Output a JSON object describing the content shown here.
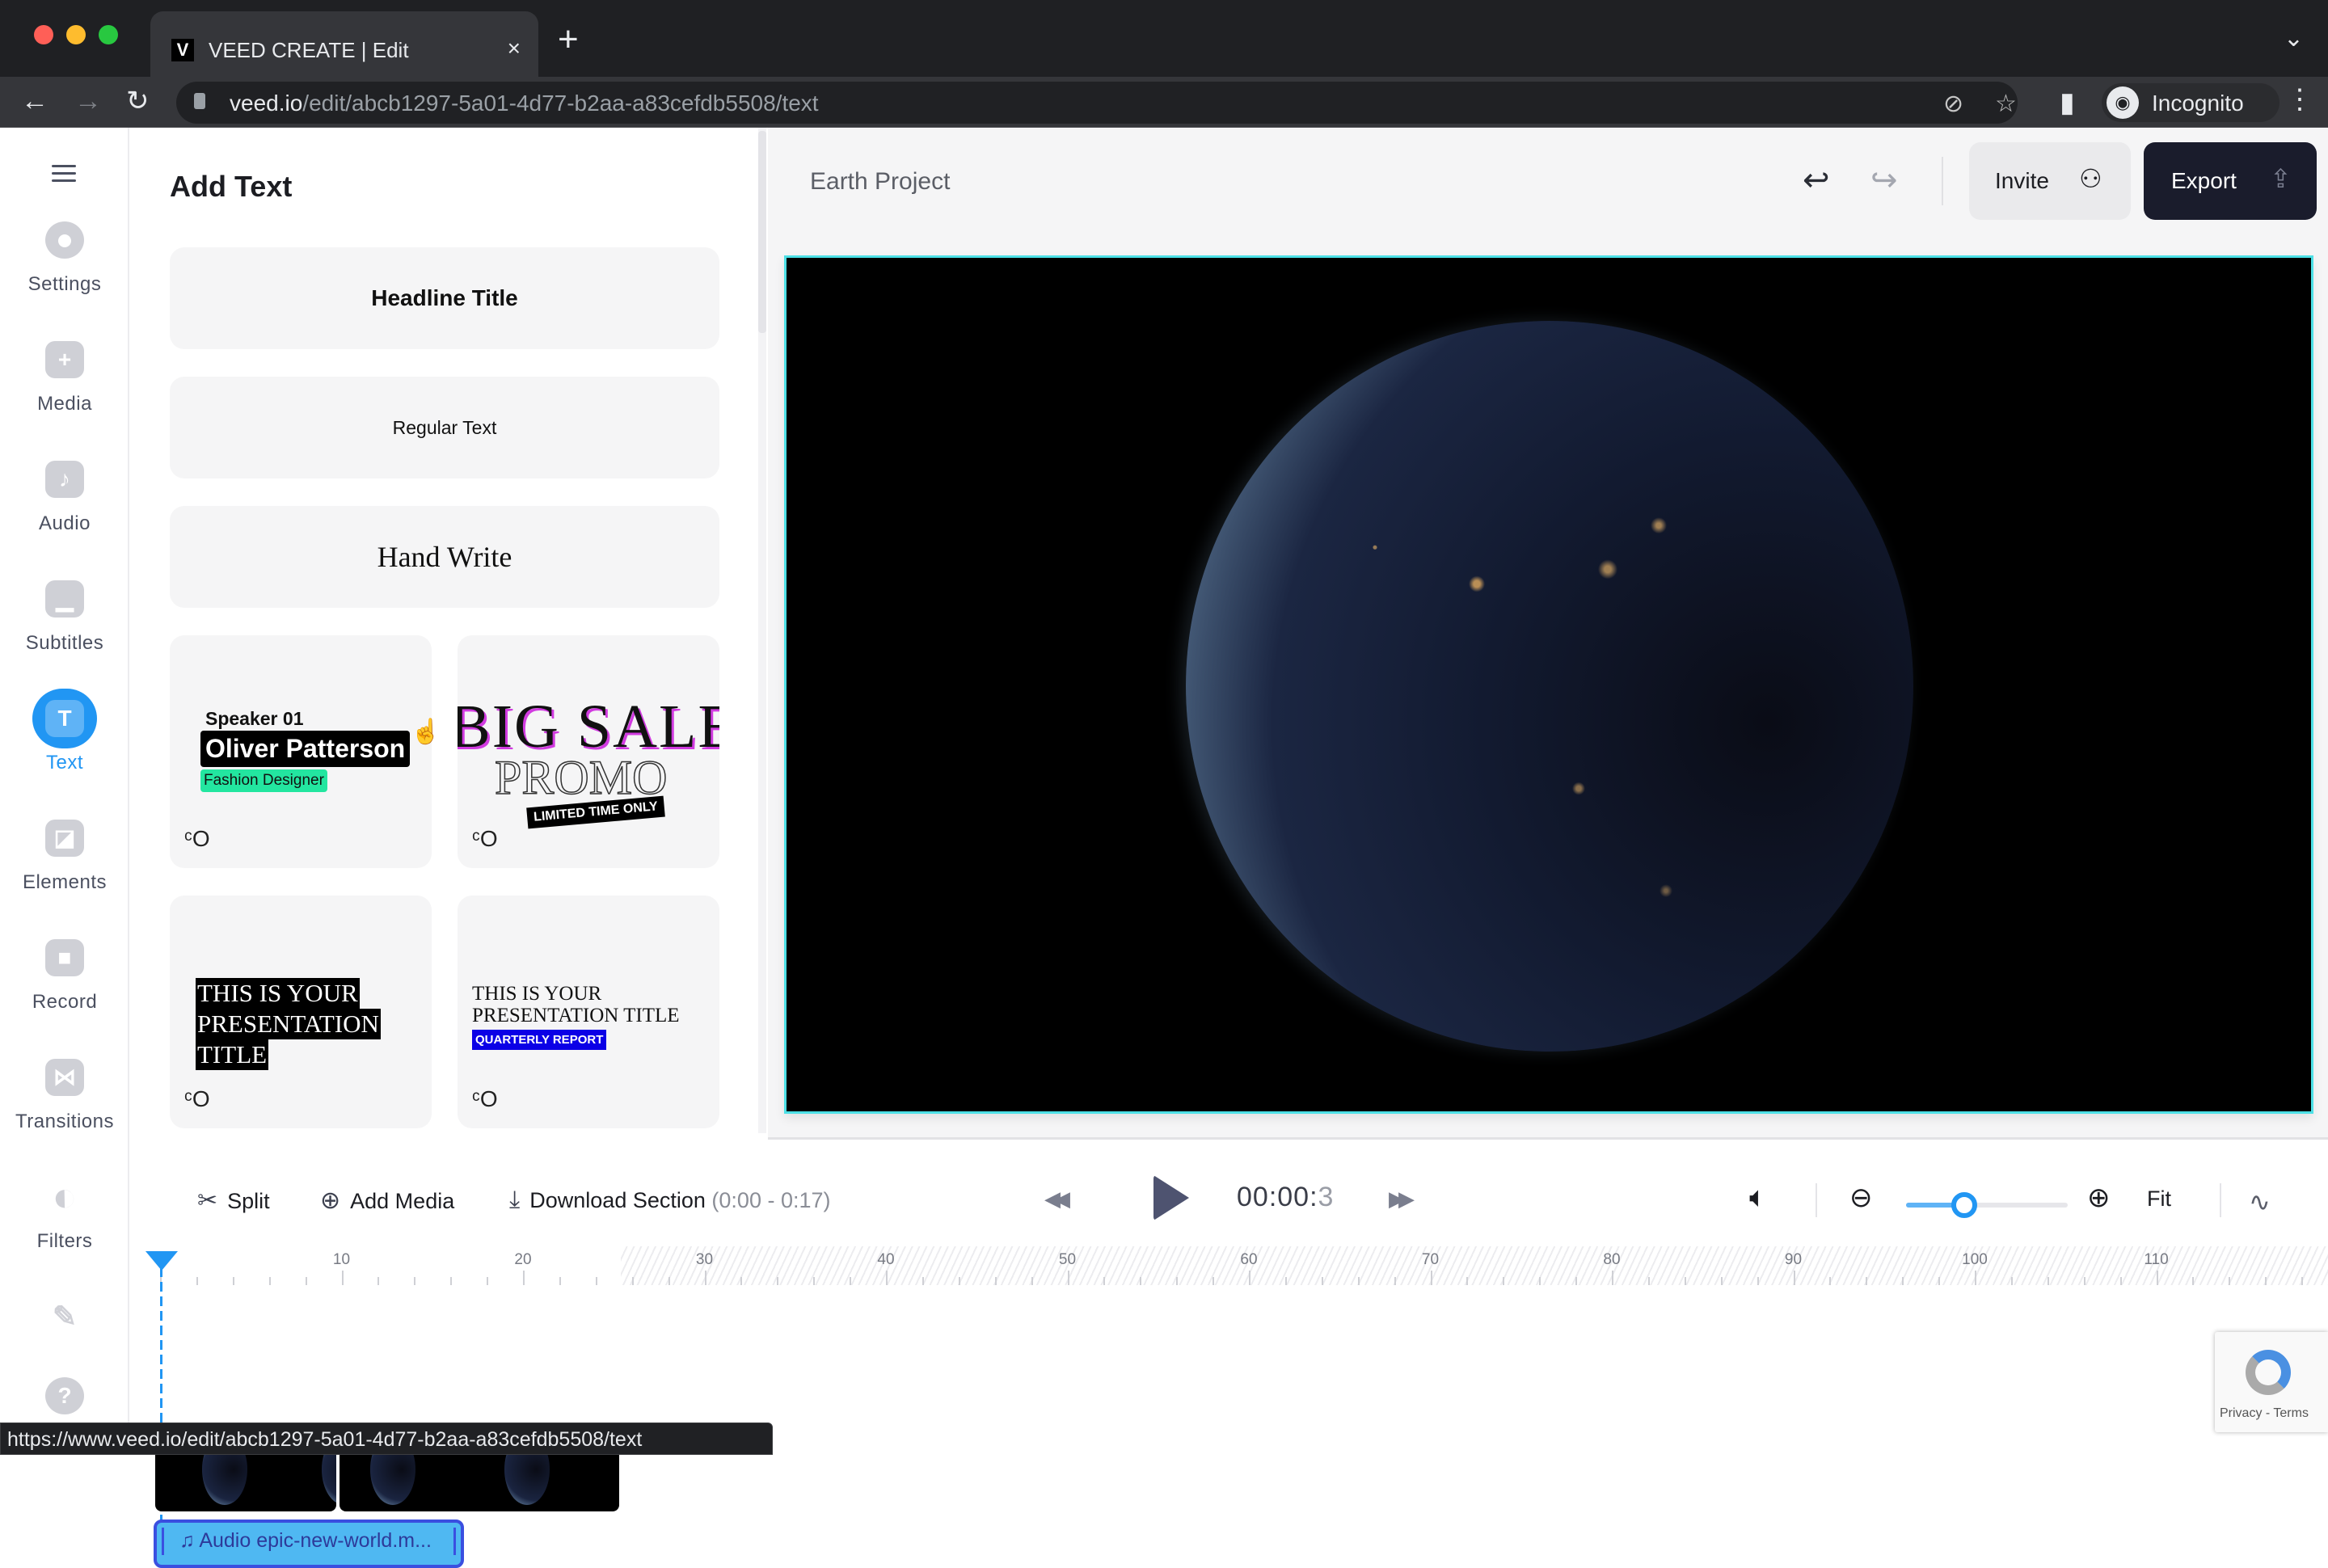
{
  "browser": {
    "tab_title": "VEED CREATE | Edit",
    "favicon_letter": "V",
    "url_host": "veed.io",
    "url_path": "/edit/abcb1297-5a01-4d77-b2aa-a83cefdb5508/text",
    "profile_label": "Incognito",
    "status_url": "https://www.veed.io/edit/abcb1297-5a01-4d77-b2aa-a83cefdb5508/text"
  },
  "sidebar": {
    "items": [
      {
        "label": "Settings",
        "icon": "settings-icon",
        "glyph": ""
      },
      {
        "label": "Media",
        "icon": "plus-icon",
        "glyph": "+"
      },
      {
        "label": "Audio",
        "icon": "music-note-icon",
        "glyph": "♪"
      },
      {
        "label": "Subtitles",
        "icon": "subtitles-icon",
        "glyph": "▁"
      },
      {
        "label": "Text",
        "icon": "text-icon",
        "glyph": "T",
        "active": true
      },
      {
        "label": "Elements",
        "icon": "sticker-icon",
        "glyph": "◪"
      },
      {
        "label": "Record",
        "icon": "camera-icon",
        "glyph": "■"
      },
      {
        "label": "Transitions",
        "icon": "transition-icon",
        "glyph": "⋈"
      },
      {
        "label": "Filters",
        "icon": "filter-icon",
        "glyph": "◐"
      }
    ],
    "draw_icon": "✎",
    "help_icon": "?"
  },
  "text_panel": {
    "title": "Add Text",
    "presets": [
      "Headline Title",
      "Regular Text",
      "Hand Write"
    ],
    "templates": {
      "speaker": {
        "line1": "Speaker 01",
        "name": "Oliver Patterson",
        "role": "Fashion Designer",
        "role_color": "#23e6a0"
      },
      "sale": {
        "line1": "BIG SALE",
        "line2": "PROMO",
        "badge": "LIMITED TIME ONLY",
        "accent": "#d13be0"
      },
      "presentation_dark": {
        "lines": [
          "THIS IS YOUR",
          "PRESENTATION",
          "TITLE"
        ]
      },
      "presentation_report": {
        "line1": "THIS IS YOUR",
        "line2": "PRESENTATION TITLE",
        "badge": "QUARTERLY REPORT",
        "badge_color": "#0b00e6"
      }
    }
  },
  "project": {
    "title": "Earth Project",
    "invite_label": "Invite",
    "export_label": "Export"
  },
  "timeline": {
    "split_label": "Split",
    "add_media_label": "Add Media",
    "download_label": "Download Section",
    "download_range": "(0:00 - 0:17)",
    "time_main": "00:00:",
    "time_frac": "3",
    "fit_label": "Fit",
    "zoom_level": 0.36,
    "ruler_labels": [
      "10",
      "20",
      "30",
      "40",
      "50",
      "60",
      "70",
      "80",
      "90",
      "100",
      "110"
    ],
    "audio_label": "Audio epic-new-world.m..."
  },
  "recaptcha": {
    "links": "Privacy - Terms"
  },
  "colors": {
    "accent": "#2196f3",
    "export_bg": "#1a1c2c",
    "canvas_border": "#4de0e6"
  }
}
